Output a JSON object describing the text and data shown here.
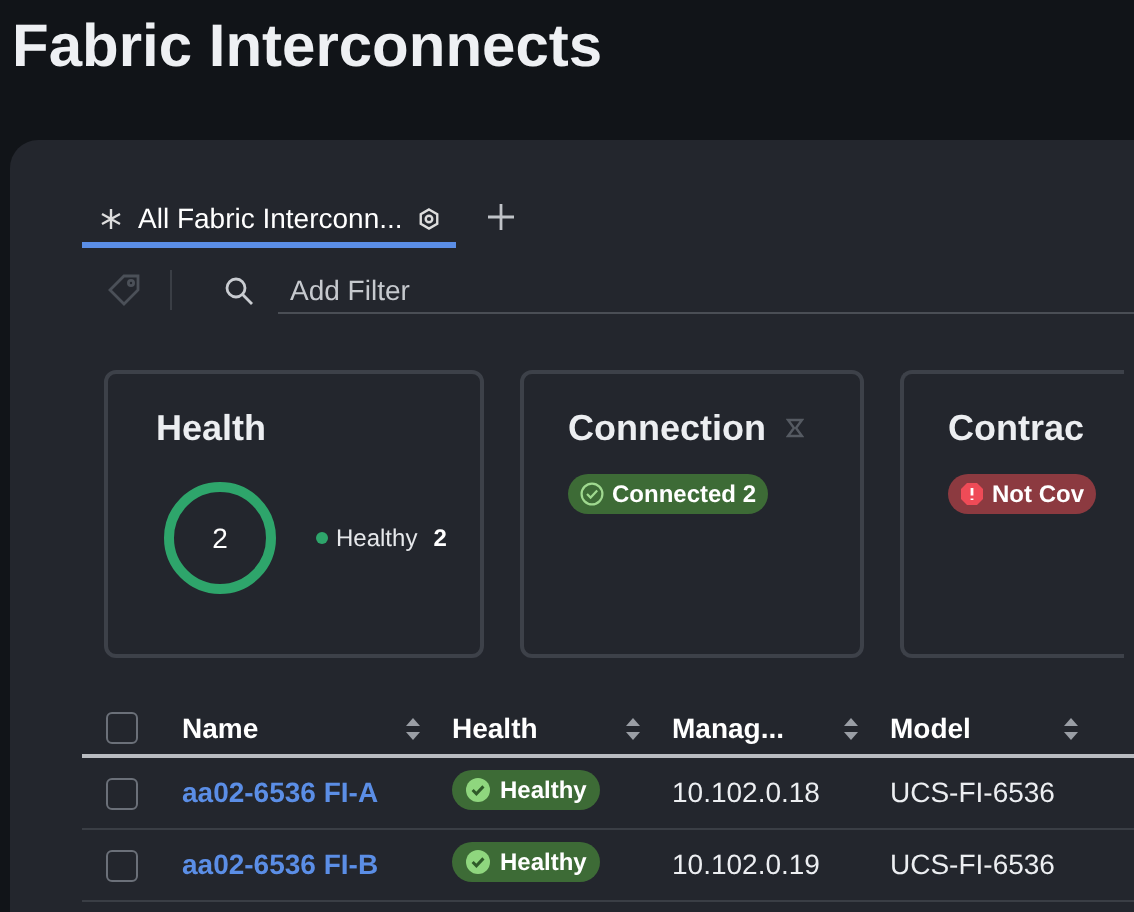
{
  "page_title": "Fabric Interconnects",
  "tabs": [
    {
      "label": "All Fabric Interconn...",
      "selected": true
    }
  ],
  "filter": {
    "placeholder": "Add Filter"
  },
  "cards": [
    {
      "kind": "donut",
      "title": "Health",
      "total": "2",
      "legend": [
        {
          "label": "Healthy",
          "count": "2",
          "color": "#2ea56b"
        }
      ]
    },
    {
      "kind": "pills",
      "title": "Connection",
      "filterable": true,
      "pills": [
        {
          "label": "Connected",
          "count": "2",
          "kind": "success"
        }
      ]
    },
    {
      "kind": "pills",
      "title": "Contrac",
      "pills": [
        {
          "label": "Not Cov",
          "kind": "error"
        }
      ]
    }
  ],
  "table": {
    "select_all_checked": false,
    "columns": [
      "Name",
      "Health",
      "Manag...",
      "Model"
    ],
    "rows": [
      {
        "checked": false,
        "name": "aa02-6536 FI-A",
        "health": "Healthy",
        "management_ip": "10.102.0.18",
        "model": "UCS-FI-6536"
      },
      {
        "checked": false,
        "name": "aa02-6536 FI-B",
        "health": "Healthy",
        "management_ip": "10.102.0.19",
        "model": "UCS-FI-6536"
      }
    ]
  }
}
